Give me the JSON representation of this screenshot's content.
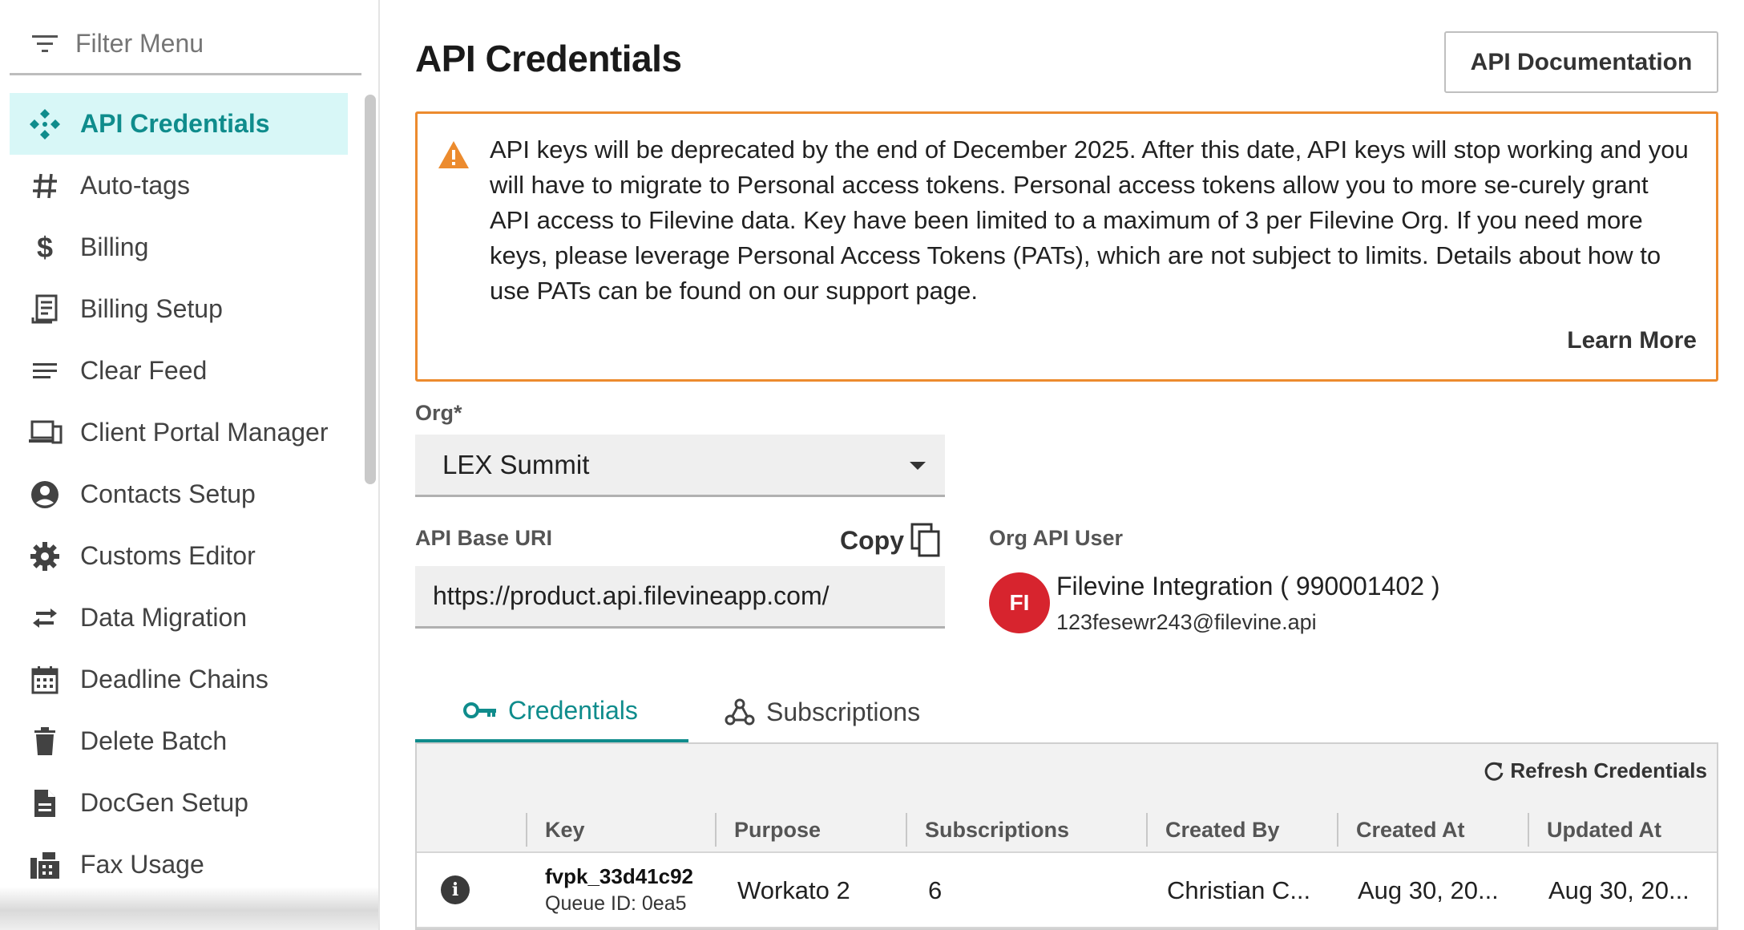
{
  "sidebar": {
    "filter_placeholder": "Filter Menu",
    "items": [
      {
        "label": "API Credentials",
        "icon": "api-icon",
        "active": true
      },
      {
        "label": "Auto-tags",
        "icon": "hash-icon"
      },
      {
        "label": "Billing",
        "icon": "dollar-icon"
      },
      {
        "label": "Billing Setup",
        "icon": "receipt-icon"
      },
      {
        "label": "Clear Feed",
        "icon": "lines-icon"
      },
      {
        "label": "Client Portal Manager",
        "icon": "devices-icon"
      },
      {
        "label": "Contacts Setup",
        "icon": "account-circle-icon"
      },
      {
        "label": "Customs Editor",
        "icon": "gear-icon"
      },
      {
        "label": "Data Migration",
        "icon": "swap-icon"
      },
      {
        "label": "Deadline Chains",
        "icon": "calendar-icon"
      },
      {
        "label": "Delete Batch",
        "icon": "trash-icon"
      },
      {
        "label": "DocGen Setup",
        "icon": "document-icon"
      },
      {
        "label": "Fax Usage",
        "icon": "fax-icon"
      }
    ]
  },
  "header": {
    "title": "API Credentials",
    "docs_button": "API Documentation"
  },
  "alert": {
    "message": "API keys will be deprecated by the end of December 2025. After this date, API keys will stop working and you will have to migrate to Personal access tokens. Personal access tokens allow you to more se-curely grant API access to Filevine data. Key have been limited to a maximum of 3 per Filevine Org. If you need more keys, please leverage Personal Access Tokens (PATs), which are not subject to limits. Details about how to use PATs can be found on our support page.",
    "link": "Learn More",
    "color": "#ec8b2e"
  },
  "org": {
    "label": "Org*",
    "value": "LEX Summit"
  },
  "api_base": {
    "label": "API Base URI",
    "copy_label": "Copy",
    "value": "https://product.api.filevineapp.com/"
  },
  "api_user": {
    "label": "Org API User",
    "initials": "FI",
    "name": "Filevine Integration ( 990001402 )",
    "email": "123fesewr243@filevine.api"
  },
  "tabs": [
    {
      "label": "Credentials",
      "icon": "key-icon",
      "active": true
    },
    {
      "label": "Subscriptions",
      "icon": "webhook-icon"
    }
  ],
  "grid": {
    "refresh_label": "Refresh Credentials",
    "columns": [
      "Key",
      "Purpose",
      "Subscriptions",
      "Created By",
      "Created At",
      "Updated At"
    ],
    "rows": [
      {
        "key": "fvpk_33d41c92",
        "queue": "Queue ID: 0ea5",
        "purpose": "Workato 2",
        "subscriptions": "6",
        "created_by": "Christian C...",
        "created_at": "Aug 30, 20...",
        "updated_at": "Aug 30, 20..."
      }
    ]
  },
  "colors": {
    "accent": "#0f8c8c",
    "active_bg": "#d8f7f7",
    "warning": "#ec8b2e",
    "avatar": "#d7242e"
  }
}
